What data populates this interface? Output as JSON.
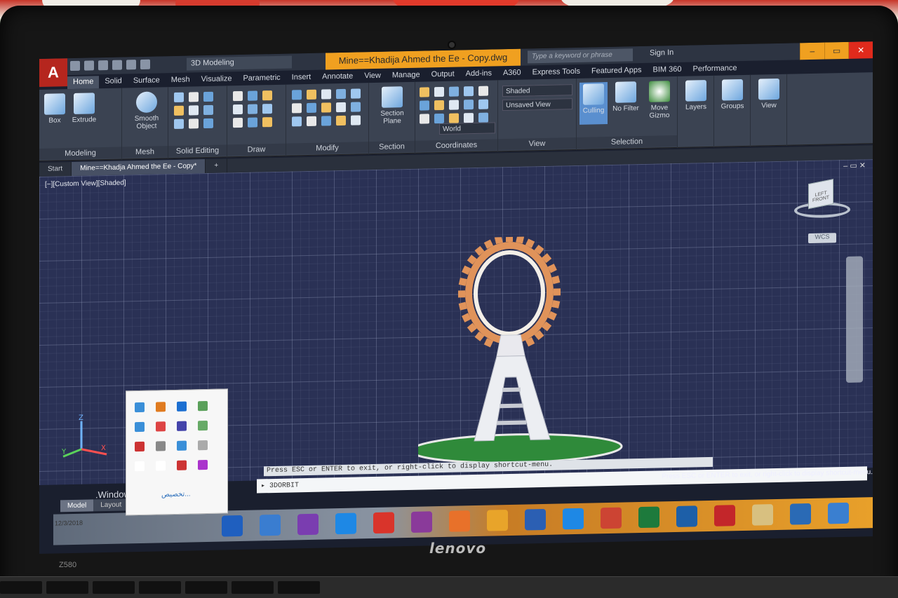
{
  "autocad": {
    "workspace": "3D Modeling",
    "document_title": "Mine==Khadija Ahmed the Ee - Copy.dwg",
    "search_placeholder": "Type a keyword or phrase",
    "sign_in": "Sign In",
    "ribbon_tabs": [
      "Home",
      "Solid",
      "Surface",
      "Mesh",
      "Visualize",
      "Parametric",
      "Insert",
      "Annotate",
      "View",
      "Manage",
      "Output",
      "Add-ins",
      "A360",
      "Express Tools",
      "Featured Apps",
      "BIM 360",
      "Performance"
    ],
    "active_tab": "Home",
    "buttons": {
      "box": "Box",
      "extrude": "Extrude",
      "smooth_object": "Smooth Object",
      "section_plane": "Section Plane",
      "culling": "Culling",
      "no_filter": "No Filter",
      "move_gizmo": "Move Gizmo",
      "layers": "Layers",
      "groups": "Groups",
      "view": "View"
    },
    "panels": [
      "Modeling",
      "Mesh",
      "Solid Editing",
      "Draw",
      "Modify",
      "Section",
      "Coordinates",
      "View",
      "Selection"
    ],
    "dropdowns": {
      "visual_style": "Shaded",
      "view": "Unsaved View",
      "ucs": "World"
    },
    "file_tabs": [
      "Start",
      "Mine==Khadja Ahmed the Ee - Copy*"
    ],
    "viewport_label": "[−][Custom View][Shaded]",
    "viewcube": {
      "face_left": "LEFT",
      "face_front": "FRONT"
    },
    "wcs_label": "WCS",
    "command_message": "Press ESC or ENTER to exit, or right-click to display shortcut-menu.",
    "command_input": "3DORBIT",
    "status_message": "Press ESC or ENTER to exit, or right-click to display shortcut-menu.",
    "layout_tabs": [
      "Model",
      "Layout"
    ]
  },
  "windows": {
    "activate_text": ".Windows",
    "tray_link": "تخصيص...",
    "clock_date": "12/3/2018",
    "taskbar_icons": [
      "bluetooth-icon",
      "photos-icon",
      "pdf-icon",
      "media-icon",
      "autocad-icon",
      "winrar-icon",
      "player-icon",
      "search-icon",
      "word-icon",
      "ie-icon",
      "pdf-reader-icon",
      "excel-icon",
      "photoshop-icon",
      "zip-icon",
      "explorer-icon",
      "media-player-icon",
      "windows-icon"
    ]
  },
  "laptop": {
    "brand": "lenovo",
    "model": "Z580"
  },
  "colors": {
    "title_accent": "#f0a020",
    "app_red": "#b5261e",
    "viewport_bg": "#2a3155",
    "ring_orange": "#e0935a"
  }
}
